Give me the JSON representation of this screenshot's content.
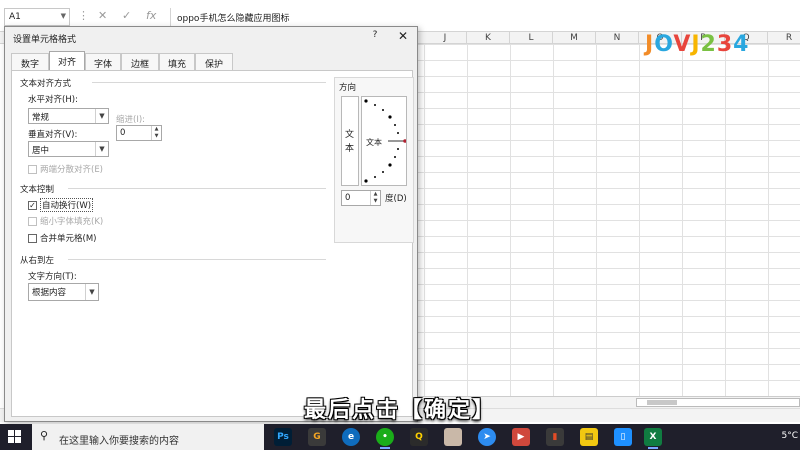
{
  "excel": {
    "name_box": "A1",
    "formula_text": "oppo手机怎么隐藏应用图标",
    "columns": [
      "J",
      "K",
      "L",
      "M",
      "N",
      "O",
      "P",
      "Q",
      "R"
    ]
  },
  "logo": {
    "text": [
      "J",
      "O",
      "V",
      "J",
      "2",
      "3",
      "4"
    ]
  },
  "dialog": {
    "title": "设置单元格格式",
    "help": "?",
    "close": "✕",
    "tabs": [
      "数字",
      "对齐",
      "字体",
      "边框",
      "填充",
      "保护"
    ],
    "active_tab": "对齐",
    "text_align": {
      "section": "文本对齐方式",
      "horizontal_label": "水平对齐(H):",
      "horizontal_value": "常规",
      "indent_label": "缩进(I):",
      "indent_value": "0",
      "vertical_label": "垂直对齐(V):",
      "vertical_value": "居中",
      "distributed_label": "两端分散对齐(E)"
    },
    "text_control": {
      "section": "文本控制",
      "wrap_label": "自动换行(W)",
      "wrap_checked": true,
      "shrink_label": "缩小字体填充(K)",
      "merge_label": "合并单元格(M)"
    },
    "rtl": {
      "section": "从右到左",
      "direction_label": "文字方向(T):",
      "direction_value": "根据内容"
    },
    "orientation": {
      "title": "方向",
      "vertical_text": [
        "文",
        "本"
      ],
      "dial_text": "文本",
      "degree_value": "0",
      "degree_label": "度(D)"
    }
  },
  "subtitle": "最后点击【确定】",
  "taskbar": {
    "search_placeholder": "在这里输入你要搜索的内容",
    "clock": "5°C"
  }
}
